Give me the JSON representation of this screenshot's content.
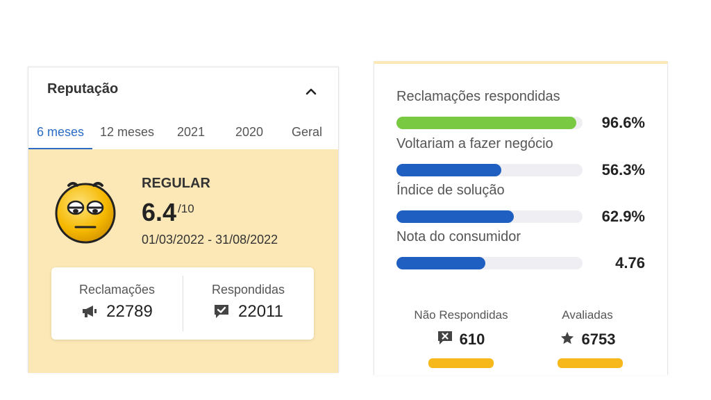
{
  "reputation": {
    "title": "Reputação",
    "tabs": [
      {
        "label": "6 meses",
        "active": true
      },
      {
        "label": "12 meses",
        "active": false
      },
      {
        "label": "2021",
        "active": false
      },
      {
        "label": "2020",
        "active": false
      },
      {
        "label": "Geral",
        "active": false
      }
    ],
    "status": "REGULAR",
    "score": "6.4",
    "scale": "/10",
    "period": "01/03/2022 - 31/08/2022",
    "panel_color": "#fbe8b6",
    "stats": {
      "complaints_label": "Reclamações",
      "complaints_value": "22789",
      "complaints_icon": "megaphone-icon",
      "answered_label": "Respondidas",
      "answered_value": "22011",
      "answered_icon": "chat-check-icon"
    }
  },
  "metrics": {
    "items": [
      {
        "label": "Reclamações respondidas",
        "value": "96.6%",
        "fraction": 0.966,
        "color": "#7ac943"
      },
      {
        "label": "Voltariam a fazer negócio",
        "value": "56.3%",
        "fraction": 0.563,
        "color": "#1f5fc1"
      },
      {
        "label": "Índice de solução",
        "value": "62.9%",
        "fraction": 0.629,
        "color": "#1f5fc1"
      },
      {
        "label": "Nota do consumidor",
        "value": "4.76",
        "fraction": 0.476,
        "color": "#1f5fc1"
      }
    ],
    "not_answered_label": "Não Respondidas",
    "not_answered_value": "610",
    "not_answered_icon": "chat-x-icon",
    "rated_label": "Avaliadas",
    "rated_value": "6753",
    "rated_icon": "star-icon",
    "accent_color": "#f7b81c"
  }
}
